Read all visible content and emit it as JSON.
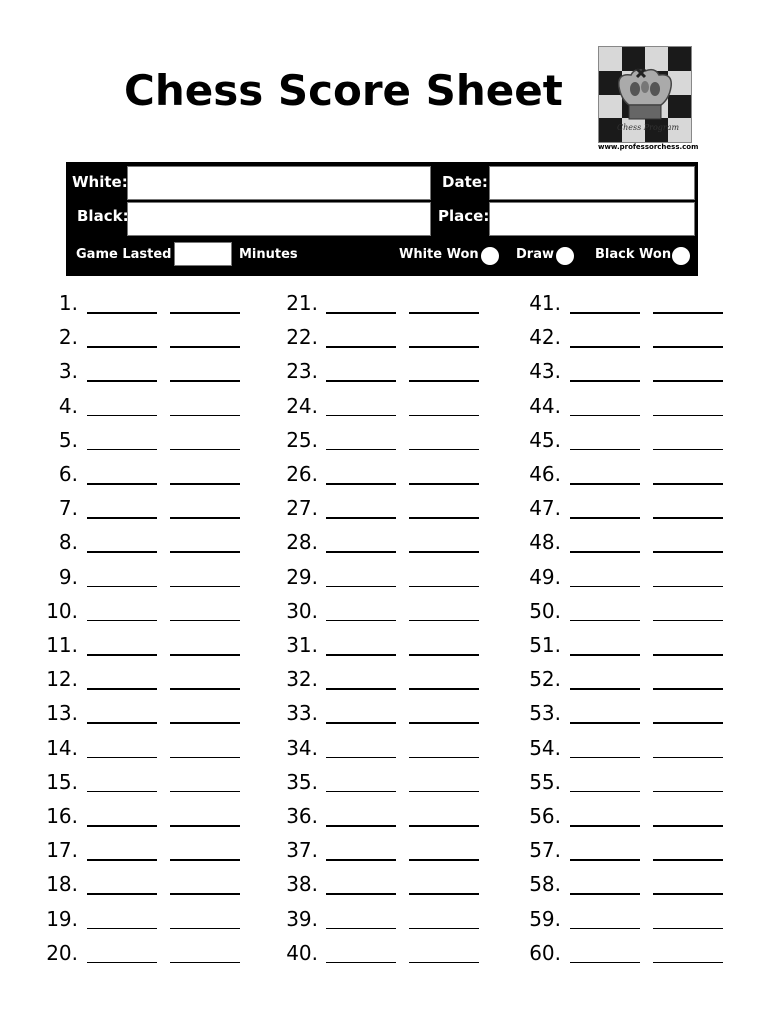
{
  "title": "Chess Score Sheet",
  "logo": {
    "icon": "chess-king-crown-icon",
    "signature": "Chess Program",
    "url": "www.professorchess.com"
  },
  "header": {
    "white_label": "White:",
    "white_value": "",
    "black_label": "Black:",
    "black_value": "",
    "date_label": "Date:",
    "date_value": "",
    "place_label": "Place:",
    "place_value": "",
    "game_lasted_label": "Game Lasted",
    "game_lasted_value": "",
    "minutes_label": "Minutes",
    "results": [
      {
        "label": "White Won",
        "selected": false
      },
      {
        "label": "Draw",
        "selected": false
      },
      {
        "label": "Black Won",
        "selected": false
      }
    ]
  },
  "moves": [
    {
      "n": "1."
    },
    {
      "n": "2."
    },
    {
      "n": "3."
    },
    {
      "n": "4."
    },
    {
      "n": "5."
    },
    {
      "n": "6."
    },
    {
      "n": "7."
    },
    {
      "n": "8."
    },
    {
      "n": "9."
    },
    {
      "n": "10."
    },
    {
      "n": "11."
    },
    {
      "n": "12."
    },
    {
      "n": "13."
    },
    {
      "n": "14."
    },
    {
      "n": "15."
    },
    {
      "n": "16."
    },
    {
      "n": "17."
    },
    {
      "n": "18."
    },
    {
      "n": "19."
    },
    {
      "n": "20."
    },
    {
      "n": "21."
    },
    {
      "n": "22."
    },
    {
      "n": "23."
    },
    {
      "n": "24."
    },
    {
      "n": "25."
    },
    {
      "n": "26."
    },
    {
      "n": "27."
    },
    {
      "n": "28."
    },
    {
      "n": "29."
    },
    {
      "n": "30."
    },
    {
      "n": "31."
    },
    {
      "n": "32."
    },
    {
      "n": "33."
    },
    {
      "n": "34."
    },
    {
      "n": "35."
    },
    {
      "n": "36."
    },
    {
      "n": "37."
    },
    {
      "n": "38."
    },
    {
      "n": "39."
    },
    {
      "n": "40."
    },
    {
      "n": "41."
    },
    {
      "n": "42."
    },
    {
      "n": "43."
    },
    {
      "n": "44."
    },
    {
      "n": "45."
    },
    {
      "n": "46."
    },
    {
      "n": "47."
    },
    {
      "n": "48."
    },
    {
      "n": "49."
    },
    {
      "n": "50."
    },
    {
      "n": "51."
    },
    {
      "n": "52."
    },
    {
      "n": "53."
    },
    {
      "n": "54."
    },
    {
      "n": "55."
    },
    {
      "n": "56."
    },
    {
      "n": "57."
    },
    {
      "n": "58."
    },
    {
      "n": "59."
    },
    {
      "n": "60."
    }
  ]
}
